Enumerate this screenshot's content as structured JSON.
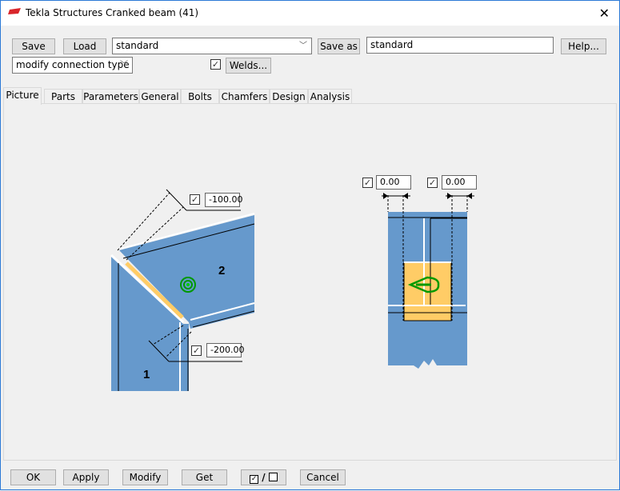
{
  "window": {
    "title": "Tekla Structures  Cranked beam (41)",
    "close_icon": "close-icon"
  },
  "toolbar": {
    "save": "Save",
    "load": "Load",
    "attribute_set": "standard",
    "save_as": "Save as",
    "save_as_name": "standard",
    "help": "Help...",
    "connection_mode": "modify connection type",
    "welds_checked": true,
    "welds": "Welds..."
  },
  "tabs": [
    {
      "label": "Picture",
      "active": true
    },
    {
      "label": "Parts"
    },
    {
      "label": "Parameters"
    },
    {
      "label": "General"
    },
    {
      "label": "Bolts"
    },
    {
      "label": "Chamfers"
    },
    {
      "label": "Design"
    },
    {
      "label": "Analysis"
    }
  ],
  "picture": {
    "dim_top": {
      "checked": true,
      "value": "-100.00"
    },
    "dim_bottom": {
      "checked": true,
      "value": "-200.00"
    },
    "dim_left": {
      "checked": true,
      "value": "0.00"
    },
    "dim_right": {
      "checked": true,
      "value": "0.00"
    },
    "part1_label": "1",
    "part2_label": "2",
    "colors": {
      "part": "#6699cc",
      "weld_plate": "#ffcc66",
      "weld_symbol": "#009900"
    }
  },
  "footer": {
    "ok": "OK",
    "apply": "Apply",
    "modify": "Modify",
    "get": "Get",
    "toggle_check": "✓",
    "toggle_slash": "/",
    "cancel": "Cancel"
  }
}
